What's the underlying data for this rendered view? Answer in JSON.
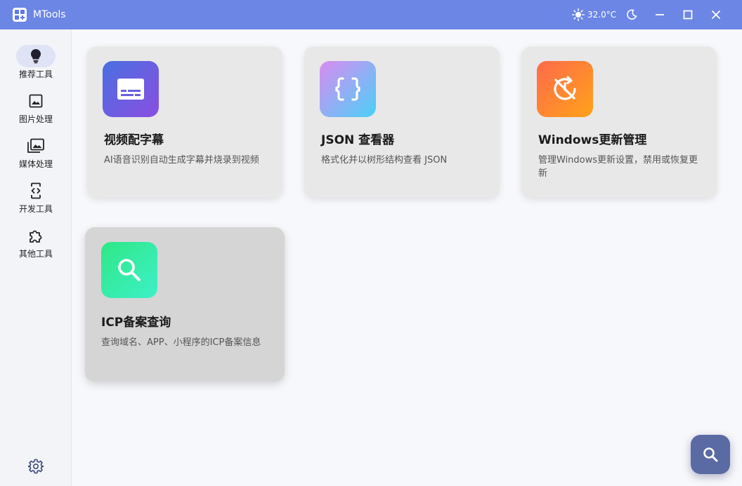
{
  "app": {
    "title": "MTools"
  },
  "titlebar": {
    "weather_icon": "sun-icon",
    "temperature": "32.0°C",
    "buttons": [
      "theme-toggle-moon-icon",
      "minimize-icon",
      "maximize-icon",
      "close-icon"
    ]
  },
  "sidebar": {
    "items": [
      {
        "label": "推荐工具",
        "icon": "lightbulb-icon",
        "active": true
      },
      {
        "label": "图片处理",
        "icon": "image-icon",
        "active": false
      },
      {
        "label": "媒体处理",
        "icon": "media-gallery-icon",
        "active": false
      },
      {
        "label": "开发工具",
        "icon": "code-device-icon",
        "active": false
      },
      {
        "label": "其他工具",
        "icon": "puzzle-icon",
        "active": false
      }
    ],
    "settings_icon": "gear-icon"
  },
  "cards": [
    {
      "title": "视频配字幕",
      "desc": "AI语音识别自动生成字幕并烧录到视频",
      "icon": "subtitles-icon",
      "gradient": [
        "#4a6fe0",
        "#8a4fe0"
      ]
    },
    {
      "title": "JSON 查看器",
      "desc": "格式化并以树形结构查看 JSON",
      "icon": "braces-icon",
      "gradient": [
        "#d98cf0",
        "#4ad0f8"
      ]
    },
    {
      "title": "Windows更新管理",
      "desc": "管理Windows更新设置，禁用或恢复更新",
      "icon": "update-disabled-icon",
      "gradient": [
        "#ff6a4a",
        "#ffa21a"
      ]
    },
    {
      "title": "ICP备案查询",
      "desc": "查询域名、APP、小程序的ICP备案信息",
      "icon": "search-icon",
      "gradient": [
        "#2ee886",
        "#3ef0c8"
      ]
    }
  ],
  "fab": {
    "icon": "search-icon"
  },
  "colors": {
    "titlebar": "#6c86e6",
    "sidebar_active": "#dfe3f6",
    "card_bg": "#e8e8e8",
    "fab_bg": "#5a6aa3"
  }
}
